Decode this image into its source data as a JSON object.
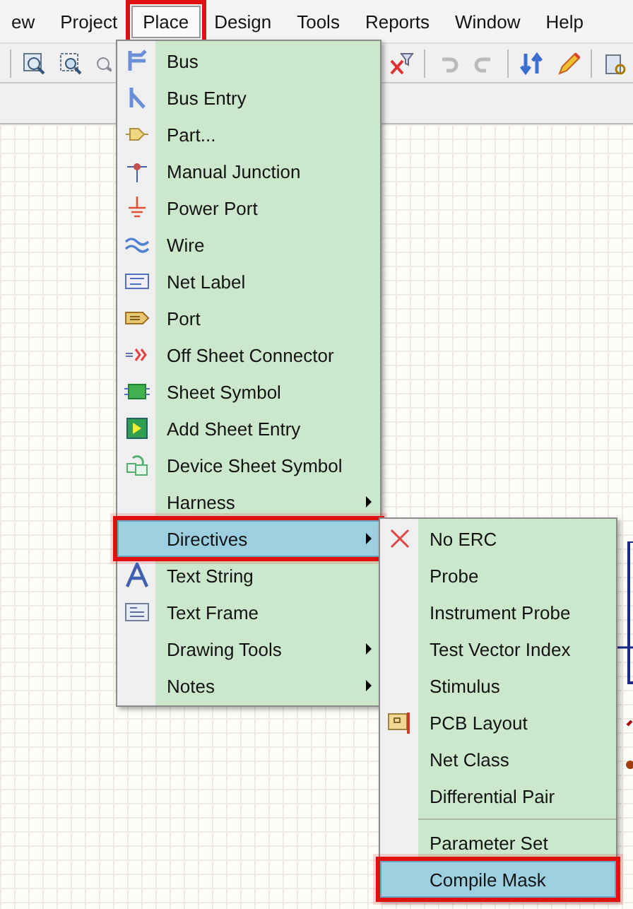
{
  "menubar": [
    {
      "label": "ew",
      "selected": false,
      "annotated": false
    },
    {
      "label": "Project",
      "selected": false,
      "annotated": false
    },
    {
      "label": "Place",
      "selected": true,
      "annotated": true
    },
    {
      "label": "Design",
      "selected": false,
      "annotated": false
    },
    {
      "label": "Tools",
      "selected": false,
      "annotated": false
    },
    {
      "label": "Reports",
      "selected": false,
      "annotated": false
    },
    {
      "label": "Window",
      "selected": false,
      "annotated": false
    },
    {
      "label": "Help",
      "selected": false,
      "annotated": false
    }
  ],
  "place_menu": {
    "items": [
      {
        "kind": "item",
        "label": "Bus",
        "submenu": false,
        "selected": false,
        "annotated": false
      },
      {
        "kind": "item",
        "label": "Bus Entry",
        "submenu": false,
        "selected": false,
        "annotated": false
      },
      {
        "kind": "item",
        "label": "Part...",
        "submenu": false,
        "selected": false,
        "annotated": false
      },
      {
        "kind": "item",
        "label": "Manual Junction",
        "submenu": false,
        "selected": false,
        "annotated": false
      },
      {
        "kind": "item",
        "label": "Power Port",
        "submenu": false,
        "selected": false,
        "annotated": false
      },
      {
        "kind": "item",
        "label": "Wire",
        "submenu": false,
        "selected": false,
        "annotated": false
      },
      {
        "kind": "item",
        "label": "Net Label",
        "submenu": false,
        "selected": false,
        "annotated": false
      },
      {
        "kind": "item",
        "label": "Port",
        "submenu": false,
        "selected": false,
        "annotated": false
      },
      {
        "kind": "item",
        "label": "Off Sheet Connector",
        "submenu": false,
        "selected": false,
        "annotated": false
      },
      {
        "kind": "item",
        "label": "Sheet Symbol",
        "submenu": false,
        "selected": false,
        "annotated": false
      },
      {
        "kind": "item",
        "label": "Add Sheet Entry",
        "submenu": false,
        "selected": false,
        "annotated": false
      },
      {
        "kind": "item",
        "label": "Device Sheet Symbol",
        "submenu": false,
        "selected": false,
        "annotated": false
      },
      {
        "kind": "item",
        "label": "Harness",
        "submenu": true,
        "selected": false,
        "annotated": false
      },
      {
        "kind": "item",
        "label": "Directives",
        "submenu": true,
        "selected": true,
        "annotated": true
      },
      {
        "kind": "item",
        "label": "Text String",
        "submenu": false,
        "selected": false,
        "annotated": false
      },
      {
        "kind": "item",
        "label": "Text Frame",
        "submenu": false,
        "selected": false,
        "annotated": false
      },
      {
        "kind": "item",
        "label": "Drawing Tools",
        "submenu": true,
        "selected": false,
        "annotated": false
      },
      {
        "kind": "item",
        "label": "Notes",
        "submenu": true,
        "selected": false,
        "annotated": false
      }
    ]
  },
  "directives_menu": {
    "items": [
      {
        "kind": "item",
        "label": "No ERC",
        "submenu": false,
        "selected": false,
        "annotated": false
      },
      {
        "kind": "item",
        "label": "Probe",
        "submenu": false,
        "selected": false,
        "annotated": false
      },
      {
        "kind": "item",
        "label": "Instrument Probe",
        "submenu": false,
        "selected": false,
        "annotated": false
      },
      {
        "kind": "item",
        "label": "Test Vector Index",
        "submenu": false,
        "selected": false,
        "annotated": false
      },
      {
        "kind": "item",
        "label": "Stimulus",
        "submenu": false,
        "selected": false,
        "annotated": false
      },
      {
        "kind": "item",
        "label": "PCB Layout",
        "submenu": false,
        "selected": false,
        "annotated": false
      },
      {
        "kind": "item",
        "label": "Net Class",
        "submenu": false,
        "selected": false,
        "annotated": false
      },
      {
        "kind": "item",
        "label": "Differential Pair",
        "submenu": false,
        "selected": false,
        "annotated": false
      },
      {
        "kind": "separator"
      },
      {
        "kind": "item",
        "label": "Parameter Set",
        "submenu": false,
        "selected": false,
        "annotated": false
      },
      {
        "kind": "item",
        "label": "Compile Mask",
        "submenu": false,
        "selected": true,
        "annotated": true
      }
    ]
  }
}
